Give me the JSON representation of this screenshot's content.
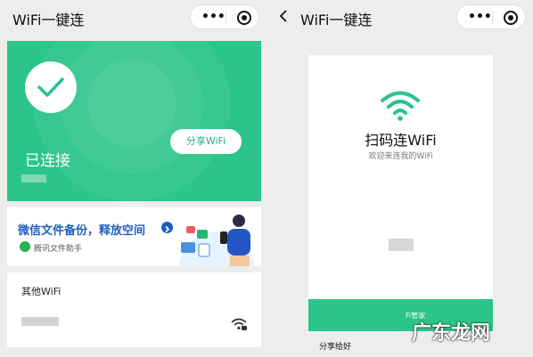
{
  "left_screen": {
    "title": "WiFi一键连",
    "connected_label": "已连接",
    "share_button": "分享WiFi",
    "banner": {
      "title": "微信文件备份，释放空间",
      "subtitle": "腾讯文件助手"
    },
    "other_wifi_title": "其他WiFi"
  },
  "right_screen": {
    "title": "WiFi一键连",
    "scan_title": "扫码连WiFi",
    "scan_subtitle": "欢迎来连我的WiFi",
    "band_text": "Fi管家",
    "share_to": "分享给好"
  },
  "watermark": "广东龙网",
  "colors": {
    "accent": "#2bc48a",
    "link_blue": "#1f5fbf"
  }
}
